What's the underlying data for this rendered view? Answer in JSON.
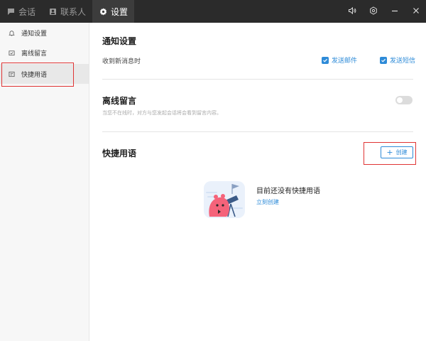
{
  "titlebar": {
    "tabs": [
      {
        "label": "会话",
        "icon": "chat-icon"
      },
      {
        "label": "联系人",
        "icon": "contacts-icon"
      },
      {
        "label": "设置",
        "icon": "gear-icon"
      }
    ],
    "active_tab": 2,
    "controls": [
      "speaker-icon",
      "settings-icon",
      "minimize-icon",
      "close-icon"
    ]
  },
  "sidebar": {
    "items": [
      {
        "label": "通知设置",
        "icon": "bell-icon"
      },
      {
        "label": "离线留言",
        "icon": "mail-check-icon"
      },
      {
        "label": "快捷用语",
        "icon": "quick-reply-icon"
      }
    ],
    "active_index": 2
  },
  "notification": {
    "title": "通知设置",
    "row_label": "收到新消息时",
    "email_label": "发送邮件",
    "sms_label": "发送短信",
    "email_checked": true,
    "sms_checked": true
  },
  "offline": {
    "title": "离线留言",
    "hint": "当您不在线时，对方与您发起会话将会看到留言内容。",
    "enabled": false
  },
  "quick": {
    "title": "快捷用语",
    "create_label": "创建",
    "empty_title": "目前还没有快捷用语",
    "empty_link": "立刻创建"
  },
  "colors": {
    "accent": "#2e8bd8",
    "titlebar": "#2b2b2b",
    "highlight_box": "#e03434"
  }
}
